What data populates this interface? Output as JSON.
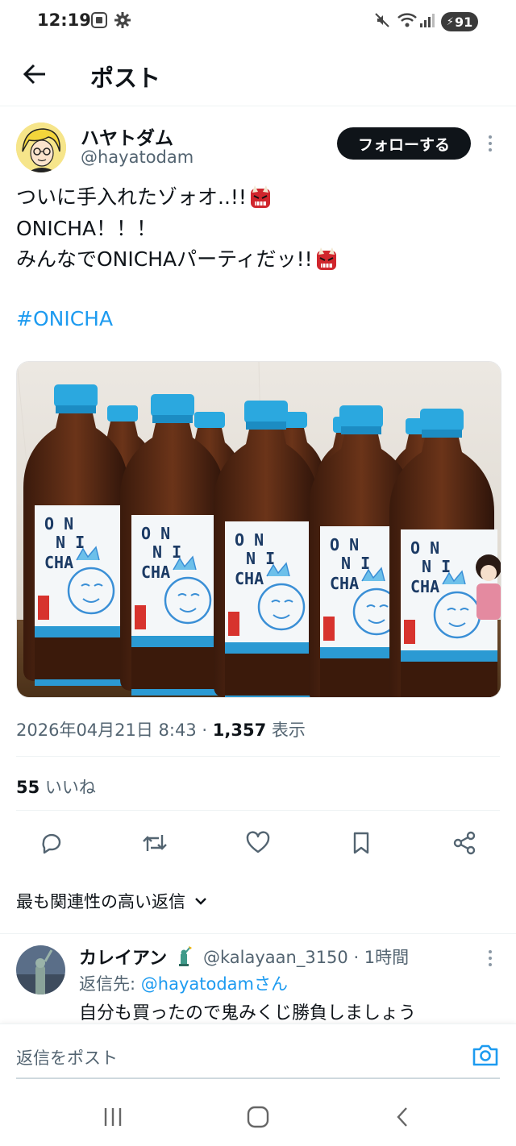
{
  "status_bar": {
    "time": "12:19",
    "battery": "91"
  },
  "header": {
    "title": "ポスト"
  },
  "author": {
    "display_name": "ハヤトダム",
    "handle": "@hayatodam",
    "follow_label": "フォローする"
  },
  "tweet": {
    "lines": [
      "ついに手入れたゾォオ..!!",
      "ONICHA！！！",
      "みんなでONICHAパーティだッ!!"
    ],
    "hashtag": "#ONICHA",
    "bottle_label": {
      "line1": "O N",
      "line2": "N I",
      "line3": "CHA"
    }
  },
  "meta": {
    "timestamp": "2026年04月21日 8:43 · ",
    "views": "1,357",
    "views_label": " 表示"
  },
  "likes": {
    "count": "55",
    "label": " いいね"
  },
  "sort": {
    "label": "最も関連性の高い返信"
  },
  "reply": {
    "name": "カレイアン",
    "handle": "@kalayaan_3150 · 1時間",
    "reply_to_prefix": "返信先: ",
    "reply_to_user": "@hayatodamさん",
    "text": "自分も買ったので鬼みくじ勝負しましょう"
  },
  "composer": {
    "placeholder": "返信をポスト"
  },
  "colors": {
    "accent": "#1d9bf0",
    "text": "#0f1419",
    "muted": "#536471",
    "bottle_cap": "#2aa9e0",
    "tea": "#5a2a14"
  }
}
